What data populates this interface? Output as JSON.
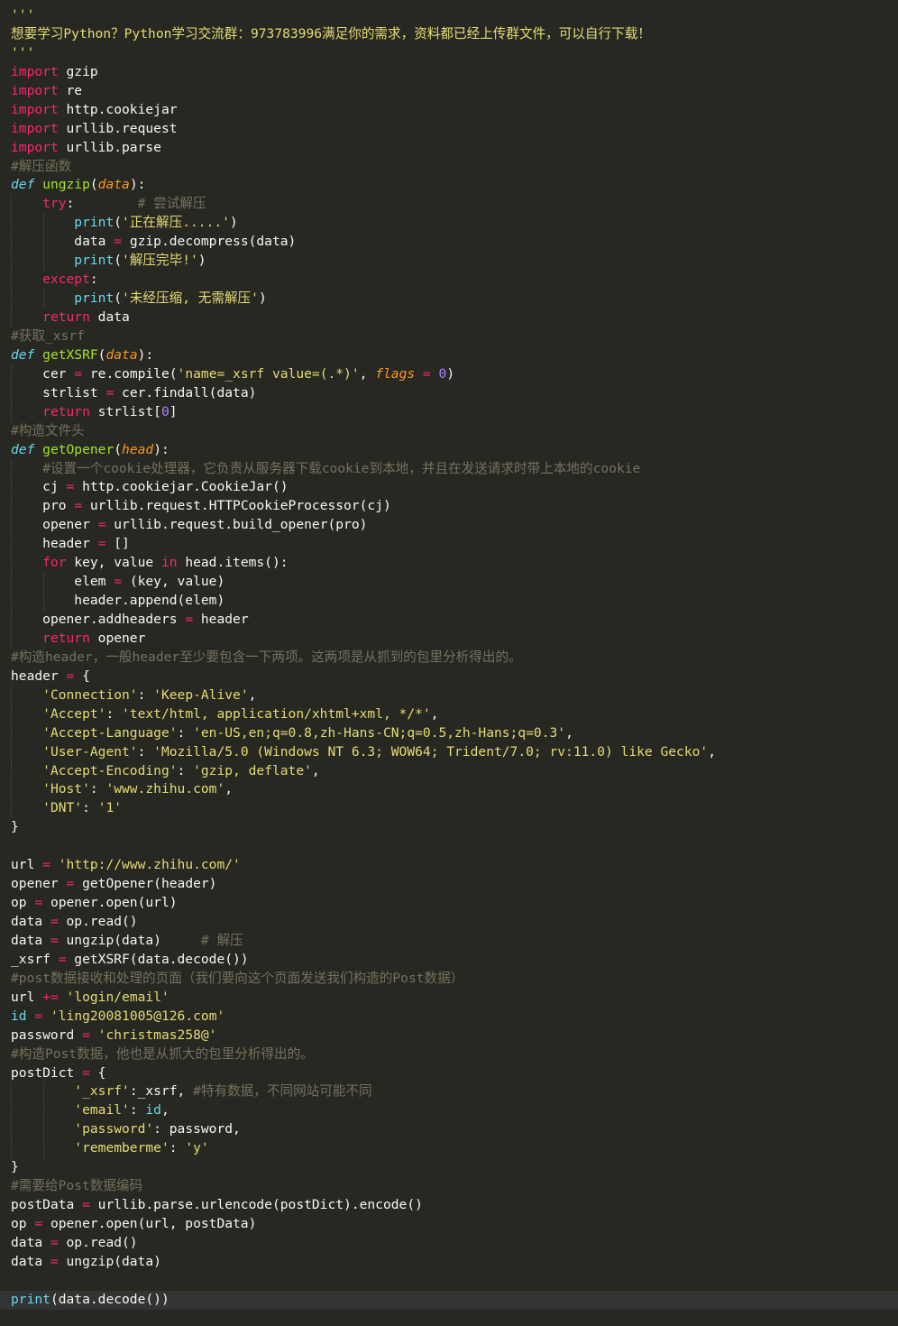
{
  "editor": {
    "theme": {
      "background": "#272822",
      "current_line": "#323333",
      "plain": "#f8f8f2",
      "string": "#e6db74",
      "keyword": "#f92672",
      "function": "#a6e22e",
      "parameter": "#fd971f",
      "builtin": "#66d9ef",
      "number": "#ae81ff",
      "comment": "#75715e"
    },
    "current_line_index": 68,
    "lines": [
      {
        "indent": 0,
        "tokens": [
          [
            "str",
            "'''"
          ]
        ]
      },
      {
        "indent": 0,
        "tokens": [
          [
            "str",
            "想要学习Python？Python学习交流群：973783996满足你的需求，资料都已经上传群文件，可以自行下载！"
          ]
        ]
      },
      {
        "indent": 0,
        "tokens": [
          [
            "str",
            "'''"
          ]
        ]
      },
      {
        "indent": 0,
        "tokens": [
          [
            "kw",
            "import"
          ],
          [
            "plain",
            " gzip"
          ]
        ]
      },
      {
        "indent": 0,
        "tokens": [
          [
            "kw",
            "import"
          ],
          [
            "plain",
            " re"
          ]
        ]
      },
      {
        "indent": 0,
        "tokens": [
          [
            "kw",
            "import"
          ],
          [
            "plain",
            " http.cookiejar"
          ]
        ]
      },
      {
        "indent": 0,
        "tokens": [
          [
            "kw",
            "import"
          ],
          [
            "plain",
            " urllib.request"
          ]
        ]
      },
      {
        "indent": 0,
        "tokens": [
          [
            "kw",
            "import"
          ],
          [
            "plain",
            " urllib.parse"
          ]
        ]
      },
      {
        "indent": 0,
        "tokens": [
          [
            "cmt",
            "#解压函数"
          ]
        ]
      },
      {
        "indent": 0,
        "tokens": [
          [
            "def",
            "def"
          ],
          [
            "plain",
            " "
          ],
          [
            "fn",
            "ungzip"
          ],
          [
            "plain",
            "("
          ],
          [
            "param",
            "data"
          ],
          [
            "plain",
            "):"
          ]
        ]
      },
      {
        "indent": 1,
        "tokens": [
          [
            "kw",
            "try"
          ],
          [
            "plain",
            ":        "
          ],
          [
            "cmt",
            "# 尝试解压"
          ]
        ]
      },
      {
        "indent": 2,
        "tokens": [
          [
            "builtin",
            "print"
          ],
          [
            "plain",
            "("
          ],
          [
            "str",
            "'正在解压.....'"
          ],
          [
            "plain",
            ")"
          ]
        ]
      },
      {
        "indent": 2,
        "tokens": [
          [
            "plain",
            "data "
          ],
          [
            "op",
            "="
          ],
          [
            "plain",
            " gzip.decompress(data)"
          ]
        ]
      },
      {
        "indent": 2,
        "tokens": [
          [
            "builtin",
            "print"
          ],
          [
            "plain",
            "("
          ],
          [
            "str",
            "'解压完毕!'"
          ],
          [
            "plain",
            ")"
          ]
        ]
      },
      {
        "indent": 1,
        "tokens": [
          [
            "kw",
            "except"
          ],
          [
            "plain",
            ":"
          ]
        ]
      },
      {
        "indent": 2,
        "tokens": [
          [
            "builtin",
            "print"
          ],
          [
            "plain",
            "("
          ],
          [
            "str",
            "'未经压缩, 无需解压'"
          ],
          [
            "plain",
            ")"
          ]
        ]
      },
      {
        "indent": 1,
        "tokens": [
          [
            "kw",
            "return"
          ],
          [
            "plain",
            " data"
          ]
        ]
      },
      {
        "indent": 0,
        "tokens": [
          [
            "cmt",
            "#获取_xsrf"
          ]
        ]
      },
      {
        "indent": 0,
        "tokens": [
          [
            "def",
            "def"
          ],
          [
            "plain",
            " "
          ],
          [
            "fn",
            "getXSRF"
          ],
          [
            "plain",
            "("
          ],
          [
            "param",
            "data"
          ],
          [
            "plain",
            "):"
          ]
        ]
      },
      {
        "indent": 1,
        "tokens": [
          [
            "plain",
            "cer "
          ],
          [
            "op",
            "="
          ],
          [
            "plain",
            " re.compile("
          ],
          [
            "str",
            "'name=_xsrf value=(.*)'"
          ],
          [
            "plain",
            ", "
          ],
          [
            "param",
            "flags"
          ],
          [
            "plain",
            " "
          ],
          [
            "op",
            "="
          ],
          [
            "plain",
            " "
          ],
          [
            "num",
            "0"
          ],
          [
            "plain",
            ")"
          ]
        ]
      },
      {
        "indent": 1,
        "tokens": [
          [
            "plain",
            "strlist "
          ],
          [
            "op",
            "="
          ],
          [
            "plain",
            " cer.findall(data)"
          ]
        ]
      },
      {
        "indent": 1,
        "tokens": [
          [
            "kw",
            "return"
          ],
          [
            "plain",
            " strlist["
          ],
          [
            "num",
            "0"
          ],
          [
            "plain",
            "]"
          ]
        ]
      },
      {
        "indent": 0,
        "tokens": [
          [
            "cmt",
            "#构造文件头"
          ]
        ]
      },
      {
        "indent": 0,
        "tokens": [
          [
            "def",
            "def"
          ],
          [
            "plain",
            " "
          ],
          [
            "fn",
            "getOpener"
          ],
          [
            "plain",
            "("
          ],
          [
            "param",
            "head"
          ],
          [
            "plain",
            "):"
          ]
        ]
      },
      {
        "indent": 1,
        "tokens": [
          [
            "cmt",
            "#设置一个cookie处理器，它负责从服务器下载cookie到本地，并且在发送请求时带上本地的cookie"
          ]
        ]
      },
      {
        "indent": 1,
        "tokens": [
          [
            "plain",
            "cj "
          ],
          [
            "op",
            "="
          ],
          [
            "plain",
            " http.cookiejar.CookieJar()"
          ]
        ]
      },
      {
        "indent": 1,
        "tokens": [
          [
            "plain",
            "pro "
          ],
          [
            "op",
            "="
          ],
          [
            "plain",
            " urllib.request.HTTPCookieProcessor(cj)"
          ]
        ]
      },
      {
        "indent": 1,
        "tokens": [
          [
            "plain",
            "opener "
          ],
          [
            "op",
            "="
          ],
          [
            "plain",
            " urllib.request.build_opener(pro)"
          ]
        ]
      },
      {
        "indent": 1,
        "tokens": [
          [
            "plain",
            "header "
          ],
          [
            "op",
            "="
          ],
          [
            "plain",
            " []"
          ]
        ]
      },
      {
        "indent": 1,
        "tokens": [
          [
            "kw",
            "for"
          ],
          [
            "plain",
            " key, value "
          ],
          [
            "kw",
            "in"
          ],
          [
            "plain",
            " head.items():"
          ]
        ]
      },
      {
        "indent": 2,
        "tokens": [
          [
            "plain",
            "elem "
          ],
          [
            "op",
            "="
          ],
          [
            "plain",
            " (key, value)"
          ]
        ]
      },
      {
        "indent": 2,
        "tokens": [
          [
            "plain",
            "header.append(elem)"
          ]
        ]
      },
      {
        "indent": 1,
        "tokens": [
          [
            "plain",
            "opener.addheaders "
          ],
          [
            "op",
            "="
          ],
          [
            "plain",
            " header"
          ]
        ]
      },
      {
        "indent": 1,
        "tokens": [
          [
            "kw",
            "return"
          ],
          [
            "plain",
            " opener"
          ]
        ]
      },
      {
        "indent": 0,
        "tokens": [
          [
            "cmt",
            "#构造header，一般header至少要包含一下两项。这两项是从抓到的包里分析得出的。"
          ]
        ]
      },
      {
        "indent": 0,
        "tokens": [
          [
            "plain",
            "header "
          ],
          [
            "op",
            "="
          ],
          [
            "plain",
            " {"
          ]
        ]
      },
      {
        "indent": 1,
        "tokens": [
          [
            "str",
            "'Connection'"
          ],
          [
            "plain",
            ": "
          ],
          [
            "str",
            "'Keep-Alive'"
          ],
          [
            "plain",
            ","
          ]
        ]
      },
      {
        "indent": 1,
        "tokens": [
          [
            "str",
            "'Accept'"
          ],
          [
            "plain",
            ": "
          ],
          [
            "str",
            "'text/html, application/xhtml+xml, */*'"
          ],
          [
            "plain",
            ","
          ]
        ]
      },
      {
        "indent": 1,
        "tokens": [
          [
            "str",
            "'Accept-Language'"
          ],
          [
            "plain",
            ": "
          ],
          [
            "str",
            "'en-US,en;q=0.8,zh-Hans-CN;q=0.5,zh-Hans;q=0.3'"
          ],
          [
            "plain",
            ","
          ]
        ]
      },
      {
        "indent": 1,
        "tokens": [
          [
            "str",
            "'User-Agent'"
          ],
          [
            "plain",
            ": "
          ],
          [
            "str",
            "'Mozilla/5.0 (Windows NT 6.3; WOW64; Trident/7.0; rv:11.0) like Gecko'"
          ],
          [
            "plain",
            ","
          ]
        ]
      },
      {
        "indent": 1,
        "tokens": [
          [
            "str",
            "'Accept-Encoding'"
          ],
          [
            "plain",
            ": "
          ],
          [
            "str",
            "'gzip, deflate'"
          ],
          [
            "plain",
            ","
          ]
        ]
      },
      {
        "indent": 1,
        "tokens": [
          [
            "str",
            "'Host'"
          ],
          [
            "plain",
            ": "
          ],
          [
            "str",
            "'www.zhihu.com'"
          ],
          [
            "plain",
            ","
          ]
        ]
      },
      {
        "indent": 1,
        "tokens": [
          [
            "str",
            "'DNT'"
          ],
          [
            "plain",
            ": "
          ],
          [
            "str",
            "'1'"
          ]
        ]
      },
      {
        "indent": 0,
        "tokens": [
          [
            "plain",
            "}"
          ]
        ]
      },
      {
        "indent": 0,
        "tokens": []
      },
      {
        "indent": 0,
        "tokens": [
          [
            "plain",
            "url "
          ],
          [
            "op",
            "="
          ],
          [
            "plain",
            " "
          ],
          [
            "str",
            "'http://www.zhihu.com/'"
          ]
        ]
      },
      {
        "indent": 0,
        "tokens": [
          [
            "plain",
            "opener "
          ],
          [
            "op",
            "="
          ],
          [
            "plain",
            " getOpener(header)"
          ]
        ]
      },
      {
        "indent": 0,
        "tokens": [
          [
            "plain",
            "op "
          ],
          [
            "op",
            "="
          ],
          [
            "plain",
            " opener.open(url)"
          ]
        ]
      },
      {
        "indent": 0,
        "tokens": [
          [
            "plain",
            "data "
          ],
          [
            "op",
            "="
          ],
          [
            "plain",
            " op.read()"
          ]
        ]
      },
      {
        "indent": 0,
        "tokens": [
          [
            "plain",
            "data "
          ],
          [
            "op",
            "="
          ],
          [
            "plain",
            " ungzip(data)     "
          ],
          [
            "cmt",
            "# 解压"
          ]
        ]
      },
      {
        "indent": 0,
        "tokens": [
          [
            "plain",
            "_xsrf "
          ],
          [
            "op",
            "="
          ],
          [
            "plain",
            " getXSRF(data.decode())"
          ]
        ]
      },
      {
        "indent": 0,
        "tokens": [
          [
            "cmt",
            "#post数据接收和处理的页面（我们要向这个页面发送我们构造的Post数据）"
          ]
        ]
      },
      {
        "indent": 0,
        "tokens": [
          [
            "plain",
            "url "
          ],
          [
            "op",
            "+="
          ],
          [
            "plain",
            " "
          ],
          [
            "str",
            "'login/email'"
          ]
        ]
      },
      {
        "indent": 0,
        "tokens": [
          [
            "builtin",
            "id"
          ],
          [
            "plain",
            " "
          ],
          [
            "op",
            "="
          ],
          [
            "plain",
            " "
          ],
          [
            "str",
            "'ling20081005@126.com'"
          ]
        ]
      },
      {
        "indent": 0,
        "tokens": [
          [
            "plain",
            "password "
          ],
          [
            "op",
            "="
          ],
          [
            "plain",
            " "
          ],
          [
            "str",
            "'christmas258@'"
          ]
        ]
      },
      {
        "indent": 0,
        "tokens": [
          [
            "cmt",
            "#构造Post数据，他也是从抓大的包里分析得出的。"
          ]
        ]
      },
      {
        "indent": 0,
        "tokens": [
          [
            "plain",
            "postDict "
          ],
          [
            "op",
            "="
          ],
          [
            "plain",
            " {"
          ]
        ]
      },
      {
        "indent": 2,
        "tokens": [
          [
            "str",
            "'_xsrf'"
          ],
          [
            "plain",
            ":_xsrf, "
          ],
          [
            "cmt",
            "#特有数据，不同网站可能不同"
          ]
        ]
      },
      {
        "indent": 2,
        "tokens": [
          [
            "str",
            "'email'"
          ],
          [
            "plain",
            ": "
          ],
          [
            "builtin",
            "id"
          ],
          [
            "plain",
            ","
          ]
        ]
      },
      {
        "indent": 2,
        "tokens": [
          [
            "str",
            "'password'"
          ],
          [
            "plain",
            ": password,"
          ]
        ]
      },
      {
        "indent": 2,
        "tokens": [
          [
            "str",
            "'rememberme'"
          ],
          [
            "plain",
            ": "
          ],
          [
            "str",
            "'y'"
          ]
        ]
      },
      {
        "indent": 0,
        "tokens": [
          [
            "plain",
            "}"
          ]
        ]
      },
      {
        "indent": 0,
        "tokens": [
          [
            "cmt",
            "#需要给Post数据编码"
          ]
        ]
      },
      {
        "indent": 0,
        "tokens": [
          [
            "plain",
            "postData "
          ],
          [
            "op",
            "="
          ],
          [
            "plain",
            " urllib.parse.urlencode(postDict).encode()"
          ]
        ]
      },
      {
        "indent": 0,
        "tokens": [
          [
            "plain",
            "op "
          ],
          [
            "op",
            "="
          ],
          [
            "plain",
            " opener.open(url, postData)"
          ]
        ]
      },
      {
        "indent": 0,
        "tokens": [
          [
            "plain",
            "data "
          ],
          [
            "op",
            "="
          ],
          [
            "plain",
            " op.read()"
          ]
        ]
      },
      {
        "indent": 0,
        "tokens": [
          [
            "plain",
            "data "
          ],
          [
            "op",
            "="
          ],
          [
            "plain",
            " ungzip(data)"
          ]
        ]
      },
      {
        "indent": 0,
        "tokens": []
      },
      {
        "indent": 0,
        "tokens": [
          [
            "builtin",
            "print"
          ],
          [
            "plain",
            "(data.decode())"
          ]
        ]
      }
    ]
  }
}
